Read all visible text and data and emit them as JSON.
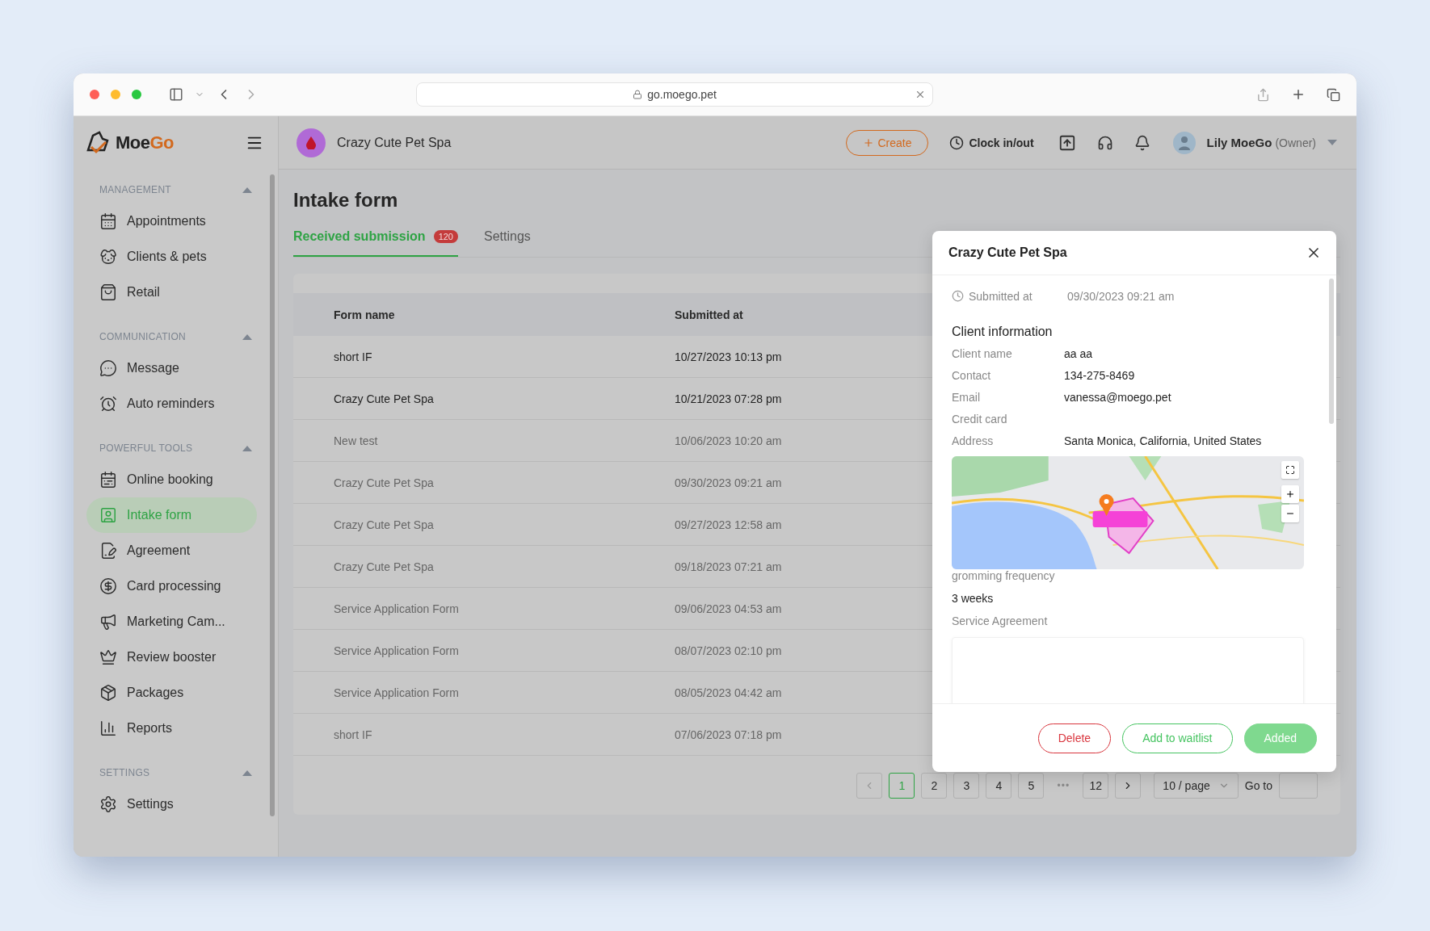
{
  "browser": {
    "url": "go.moego.pet"
  },
  "sidebar": {
    "logo": [
      "Moe",
      "Go"
    ],
    "sections": [
      {
        "title": "MANAGEMENT",
        "expanded": true,
        "items": [
          {
            "label": "Appointments",
            "selected": false
          },
          {
            "label": "Clients & pets",
            "selected": false
          },
          {
            "label": "Retail",
            "selected": false
          }
        ]
      },
      {
        "title": "COMMUNICATION",
        "expanded": true,
        "items": [
          {
            "label": "Message",
            "selected": false
          },
          {
            "label": "Auto reminders",
            "selected": false
          }
        ]
      },
      {
        "title": "POWERFUL TOOLS",
        "expanded": true,
        "items": [
          {
            "label": "Online booking",
            "selected": false
          },
          {
            "label": "Intake form",
            "selected": true
          },
          {
            "label": "Agreement",
            "selected": false
          },
          {
            "label": "Card processing",
            "selected": false
          },
          {
            "label": "Marketing Cam...",
            "selected": false
          },
          {
            "label": "Review booster",
            "selected": false
          },
          {
            "label": "Packages",
            "selected": false
          },
          {
            "label": "Reports",
            "selected": false
          }
        ]
      },
      {
        "title": "SETTINGS",
        "expanded": true,
        "items": [
          {
            "label": "Settings",
            "selected": false
          }
        ]
      }
    ]
  },
  "header": {
    "business": "Crazy Cute Pet Spa",
    "create": "Create",
    "clock": "Clock in/out",
    "user": "Lily MoeGo",
    "role": "(Owner)"
  },
  "page": {
    "title": "Intake form",
    "tabs": [
      {
        "label": "Received submission",
        "badge": "120",
        "selected": true
      },
      {
        "label": "Settings",
        "selected": false
      }
    ]
  },
  "table": {
    "columns": [
      "Form name",
      "Submitted at"
    ],
    "rows": [
      {
        "form_name": "short IF",
        "submitted_at": "10/27/2023 10:13 pm",
        "unread": true
      },
      {
        "form_name": "Crazy Cute Pet Spa",
        "submitted_at": "10/21/2023 07:28 pm",
        "unread": true
      },
      {
        "form_name": "New test",
        "submitted_at": "10/06/2023 10:20 am",
        "unread": false
      },
      {
        "form_name": "Crazy Cute Pet Spa",
        "submitted_at": "09/30/2023 09:21 am",
        "unread": false
      },
      {
        "form_name": "Crazy Cute Pet Spa",
        "submitted_at": "09/27/2023 12:58 am",
        "unread": false
      },
      {
        "form_name": "Crazy Cute Pet Spa",
        "submitted_at": "09/18/2023 07:21 am",
        "unread": false
      },
      {
        "form_name": "Service Application Form",
        "submitted_at": "09/06/2023 04:53 am",
        "unread": false
      },
      {
        "form_name": "Service Application Form",
        "submitted_at": "08/07/2023 02:10 pm",
        "unread": false
      },
      {
        "form_name": "Service Application Form",
        "submitted_at": "08/05/2023 04:42 am",
        "unread": false
      },
      {
        "form_name": "short IF",
        "submitted_at": "07/06/2023 07:18 pm",
        "unread": false
      }
    ]
  },
  "pagination": {
    "prev": {
      "disabled": true
    },
    "next": {
      "disabled": false
    },
    "pages": [
      {
        "kind": "page",
        "label": "1",
        "selected": true
      },
      {
        "kind": "page",
        "label": "2",
        "selected": false
      },
      {
        "kind": "page",
        "label": "3",
        "selected": false
      },
      {
        "kind": "page",
        "label": "4",
        "selected": false
      },
      {
        "kind": "page",
        "label": "5",
        "selected": false
      },
      {
        "kind": "ellipsis",
        "label": "•••"
      },
      {
        "kind": "page",
        "label": "12",
        "selected": false
      }
    ],
    "per_page": "10 / page",
    "goto": "Go to"
  },
  "modal": {
    "title": "Crazy Cute Pet Spa",
    "submitted_label": "Submitted at",
    "submitted_value": "09/30/2023 09:21 am",
    "section": "Client information",
    "fields": [
      {
        "label": "Client name",
        "value": "aa aa"
      },
      {
        "label": "Contact",
        "value": "134-275-8469"
      },
      {
        "label": "Email",
        "value": "vanessa@moego.pet"
      },
      {
        "label": "Credit card"
      },
      {
        "label": "Address",
        "value": "Santa Monica, California, United States"
      }
    ],
    "questions": [
      {
        "kind": "text",
        "label": "gromming frequency",
        "value": "3 weeks"
      },
      {
        "kind": "signature",
        "label": "Service Agreement"
      }
    ],
    "buttons": [
      {
        "kind": "danger",
        "label": "Delete"
      },
      {
        "kind": "outline",
        "label": "Add to waitlist"
      },
      {
        "kind": "primary",
        "label": "Added"
      }
    ]
  }
}
